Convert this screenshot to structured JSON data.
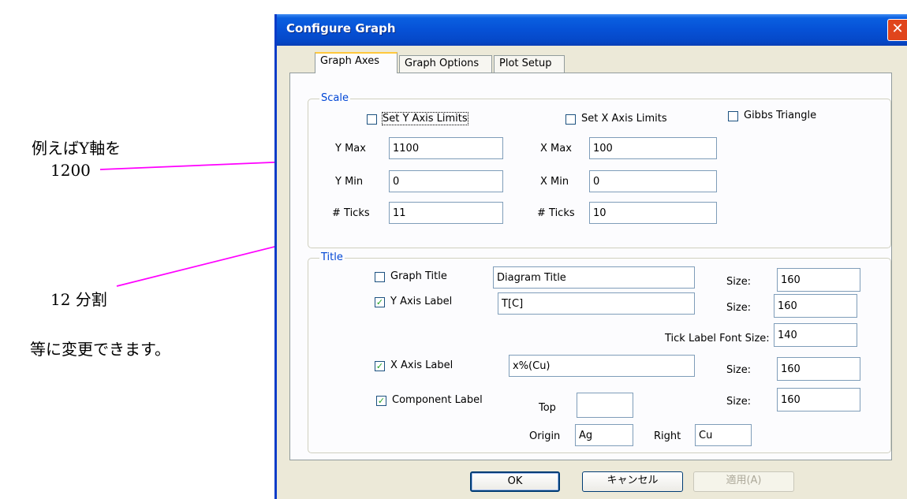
{
  "annotations": {
    "line1": "例えばY軸を",
    "line2": "1200",
    "line3": "12 分割",
    "line4": "等に変更できます。",
    "arrow_color": "#ff00ff"
  },
  "window": {
    "title": "Configure Graph",
    "close_glyph": "✕",
    "accent": "#0a5fe0"
  },
  "tabs": [
    "Graph Axes",
    "Graph Options",
    "Plot Setup"
  ],
  "scale": {
    "legend": "Scale",
    "set_y_limits_label": "Set Y Axis Limits",
    "set_x_limits_label": "Set X Axis Limits",
    "gibbs_triangle_label": "Gibbs Triangle",
    "set_y_limits_checked": false,
    "set_x_limits_checked": false,
    "gibbs_triangle_checked": false,
    "y_max_label": "Y Max",
    "y_max_value": "1100",
    "y_min_label": "Y Min",
    "y_min_value": "0",
    "y_ticks_label": "# Ticks",
    "y_ticks_value": "11",
    "x_max_label": "X Max",
    "x_max_value": "100",
    "x_min_label": "X Min",
    "x_min_value": "0",
    "x_ticks_label": "# Ticks",
    "x_ticks_value": "10"
  },
  "title_group": {
    "legend": "Title",
    "graph_title_label": "Graph Title",
    "graph_title_checked": false,
    "graph_title_value": "Diagram Title",
    "y_axis_label_label": "Y Axis Label",
    "y_axis_label_checked": true,
    "y_axis_label_value": "T[C]",
    "tick_font_size_label": "Tick Label Font Size:",
    "tick_font_size_value": "140",
    "x_axis_label_label": "X Axis Label",
    "x_axis_label_checked": true,
    "x_axis_label_value": "x%(Cu)",
    "component_label_label": "Component Label",
    "component_label_checked": true,
    "size_label": "Size:",
    "graph_title_size": "160",
    "y_axis_label_size": "160",
    "x_axis_label_size": "160",
    "component_label_size": "160",
    "top_label": "Top",
    "top_value": "",
    "origin_label": "Origin",
    "origin_value": "Ag",
    "right_label": "Right",
    "right_value": "Cu"
  },
  "buttons": {
    "ok": "OK",
    "cancel": "キャンセル",
    "apply": "適用(A)"
  }
}
